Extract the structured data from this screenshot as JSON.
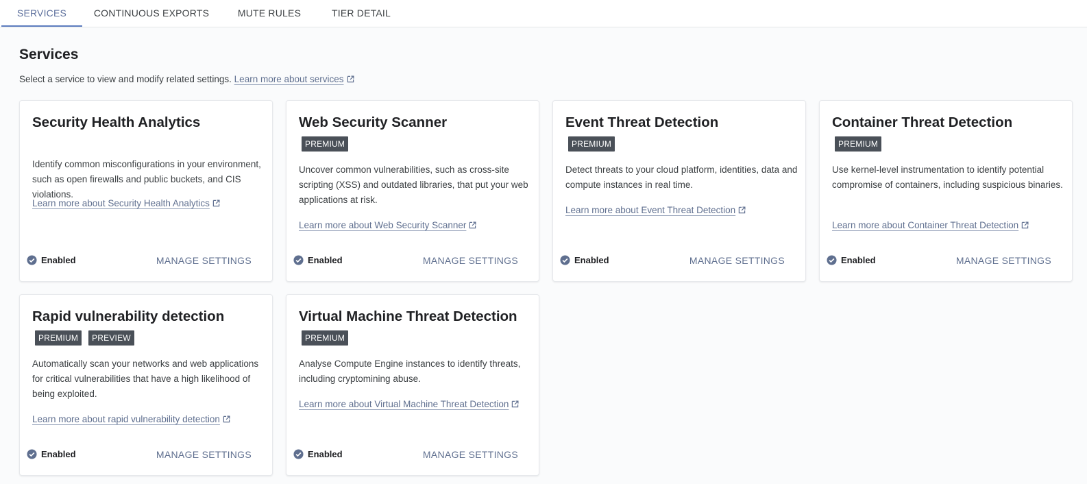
{
  "tabs": [
    {
      "label": "SERVICES",
      "active": true
    },
    {
      "label": "CONTINUOUS EXPORTS",
      "active": false
    },
    {
      "label": "MUTE RULES",
      "active": false
    },
    {
      "label": "TIER DETAIL",
      "active": false
    }
  ],
  "page": {
    "title": "Services",
    "description": "Select a service to view and modify related settings.",
    "learn_more": "Learn more about services"
  },
  "cards": [
    {
      "title": "Security Health Analytics",
      "badges": [],
      "description": "Identify common misconfigurations in your environment, such as open firewalls and public buckets, and CIS violations.",
      "link": "Learn more about Security Health Analytics",
      "status": "Enabled",
      "action": "MANAGE SETTINGS"
    },
    {
      "title": "Web Security Scanner",
      "badges": [
        "PREMIUM"
      ],
      "description": "Uncover common vulnerabilities, such as cross-site scripting (XSS) and outdated libraries, that put your web applications at risk.",
      "link": "Learn more about Web Security Scanner",
      "status": "Enabled",
      "action": "MANAGE SETTINGS"
    },
    {
      "title": "Event Threat Detection",
      "badges": [
        "PREMIUM"
      ],
      "description": "Detect threats to your cloud platform, identities, data and compute instances in real time.",
      "link": "Learn more about Event Threat Detection",
      "status": "Enabled",
      "action": "MANAGE SETTINGS"
    },
    {
      "title": "Container Threat Detection",
      "badges": [
        "PREMIUM"
      ],
      "description": "Use kernel-level instrumentation to identify potential compromise of containers, including suspicious binaries.",
      "link": "Learn more about Container Threat Detection",
      "status": "Enabled",
      "action": "MANAGE SETTINGS"
    },
    {
      "title": "Rapid vulnerability detection",
      "badges": [
        "PREMIUM",
        "PREVIEW"
      ],
      "description": "Automatically scan your networks and web applications for critical vulnerabilities that have a high likelihood of being exploited.",
      "link": "Learn more about rapid vulnerability detection",
      "status": "Enabled",
      "action": "MANAGE SETTINGS"
    },
    {
      "title": "Virtual Machine Threat Detection",
      "badges": [
        "PREMIUM"
      ],
      "description": "Analyse Compute Engine instances to identify threats, including cryptomining abuse.",
      "link": "Learn more about Virtual Machine Threat Detection",
      "status": "Enabled",
      "action": "MANAGE SETTINGS"
    }
  ],
  "colors": {
    "accent": "#5c7cbf",
    "badge_bg": "#4a5058",
    "link": "#5f6f8f"
  },
  "icons": {
    "external_link": "external-link-icon",
    "status": "check-circle-icon"
  }
}
